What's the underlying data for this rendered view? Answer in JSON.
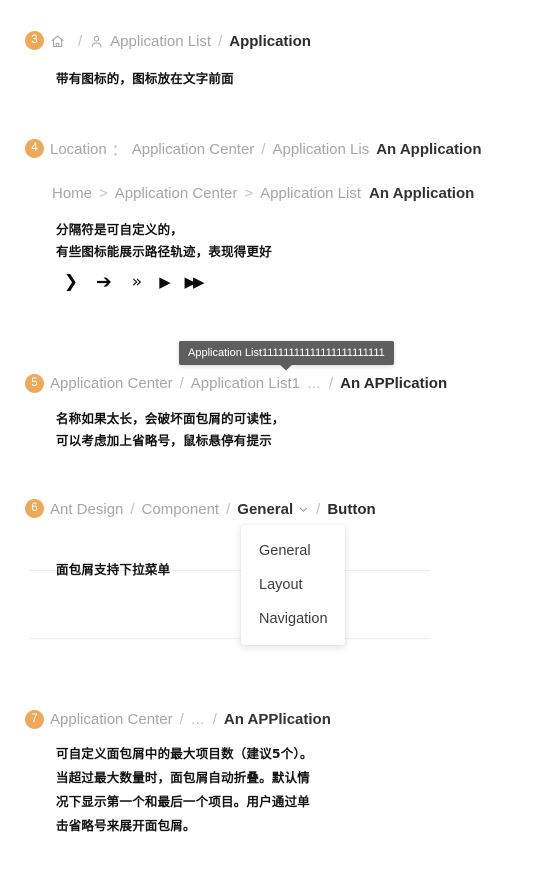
{
  "theme": {
    "badge_color": "#eda85c",
    "muted_text_color": "#a6a6a6",
    "active_text_color": "#2b2b2b",
    "separator_color": "#c2c2c2",
    "tooltip_bg": "#5e5e5e",
    "rule_color": "#ededed"
  },
  "sections": {
    "s3": {
      "number": "3",
      "crumbs": {
        "home_icon": "home-icon",
        "sep1": "/",
        "user_icon": "user-icon",
        "app_list": "Application List",
        "sep2": "/",
        "current": "Application"
      },
      "note": "带有图标的，图标放在文字前面"
    },
    "s4": {
      "number": "4",
      "row1": {
        "label": "Location",
        "colon": "：",
        "item1": "Application Center",
        "sep1": "/",
        "item2": "Application Lis",
        "current": "An Application"
      },
      "row2": {
        "item1": "Home",
        "sep1": ">",
        "item2": "Application Center",
        "sep2": ">",
        "item3": "Application List",
        "current": "An Application"
      },
      "note_line1": "分隔符是可自定义的，",
      "note_line2": "有些图标能展示路径轨迹，表现得更好",
      "glyphs": [
        {
          "name": "chevron-right-glyph",
          "char": "❯"
        },
        {
          "name": "arrow-right-glyph",
          "char": "➔"
        },
        {
          "name": "double-chevron-right-glyph",
          "char": "»"
        },
        {
          "name": "triangle-right-glyph",
          "char": "▶"
        },
        {
          "name": "double-triangle-right-glyph",
          "char": "▶▶"
        }
      ]
    },
    "s5": {
      "number": "5",
      "tooltip": "Application List11111111111111111111111",
      "crumbs": {
        "item1": "Application Center",
        "sep1": "/",
        "item2": "Application List1",
        "ellipsis": "…",
        "sep2": "/",
        "current": "An APPlication"
      },
      "note_line1": "名称如果太长，会破坏面包屑的可读性，",
      "note_line2": "可以考虑加上省略号，鼠标悬停有提示"
    },
    "s6": {
      "number": "6",
      "crumbs": {
        "item1": "Ant Design",
        "sep1": "/",
        "item2": "Component",
        "sep2": "/",
        "item3": "General",
        "chevron_icon": "chevron-down-icon",
        "sep3": "/",
        "current": "Button"
      },
      "note": "面包屑支持下拉菜单",
      "dropdown_items": [
        "General",
        "Layout",
        "Navigation"
      ]
    },
    "s7": {
      "number": "7",
      "crumbs": {
        "item1": "Application Center",
        "sep1": "/",
        "ellipsis": "…",
        "sep2": "/",
        "current": "An APPlication"
      },
      "note_lines": [
        "可自定义面包屑中的最大项目数（建议5个）。",
        "当超过最大数量时，面包屑自动折叠。默认情",
        "况下显示第一个和最后一个项目。用户通过单",
        "击省略号来展开面包屑。"
      ]
    }
  }
}
